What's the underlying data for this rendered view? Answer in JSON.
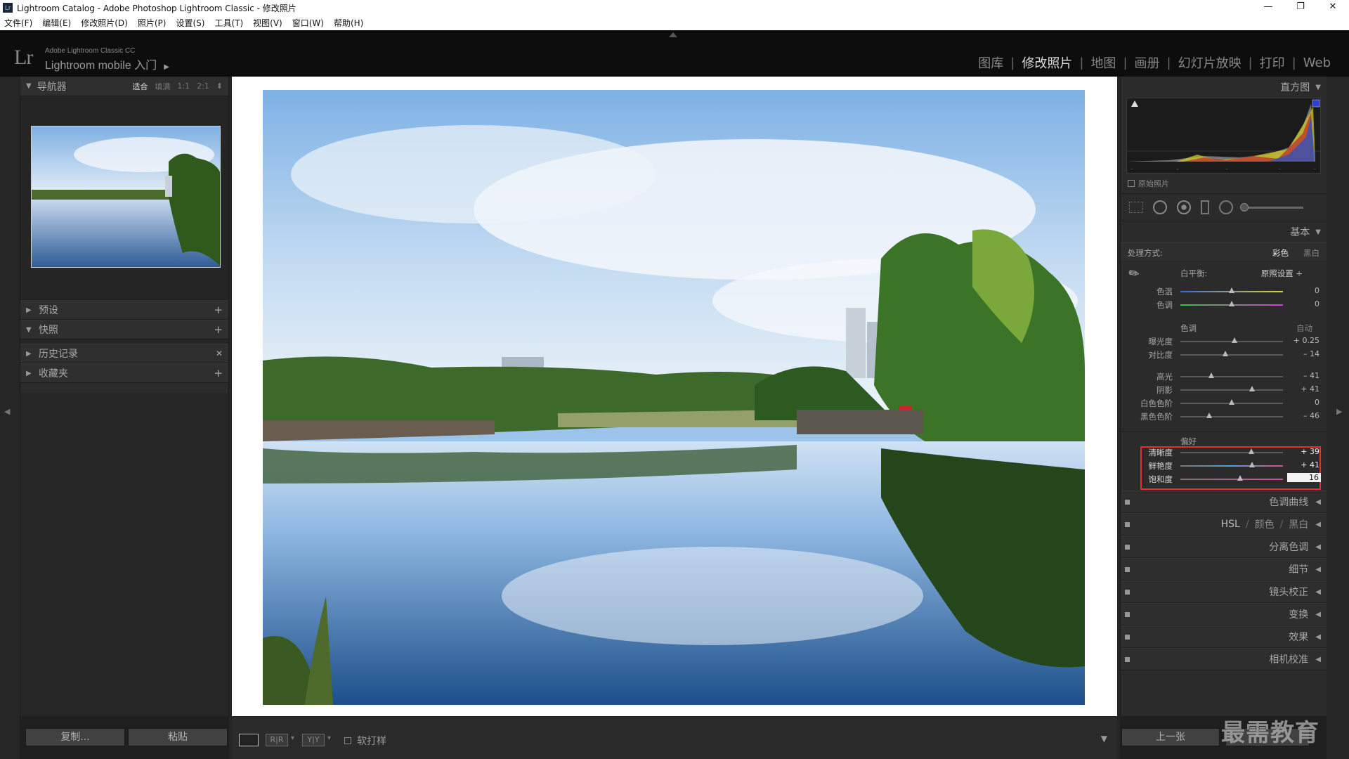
{
  "window": {
    "title": "Lightroom Catalog - Adobe Photoshop Lightroom Classic - 修改照片",
    "controls": [
      "—",
      "❐",
      "✕"
    ]
  },
  "menu": [
    "文件(F)",
    "编辑(E)",
    "修改照片(D)",
    "照片(P)",
    "设置(S)",
    "工具(T)",
    "视图(V)",
    "窗口(W)",
    "帮助(H)"
  ],
  "identity": {
    "logo": "Lr",
    "product": "Adobe Lightroom Classic CC",
    "mobile": "Lightroom mobile 入门"
  },
  "modules": {
    "items": [
      "图库",
      "修改照片",
      "地图",
      "画册",
      "幻灯片放映",
      "打印",
      "Web"
    ],
    "active": "修改照片"
  },
  "left": {
    "navigator": {
      "title": "导航器",
      "zoom": [
        "适合",
        "填满",
        "1:1",
        "2:1"
      ],
      "active_zoom": "适合"
    },
    "panels": [
      {
        "title": "预设",
        "action": "+"
      },
      {
        "title": "快照",
        "action": "+",
        "expanded": true
      },
      {
        "title": "历史记录",
        "action": "✕"
      },
      {
        "title": "收藏夹",
        "action": "+"
      }
    ],
    "copy_label": "复制...",
    "paste_label": "粘贴"
  },
  "toolbar": {
    "softproof_label": "软打样",
    "ry_label": "R|R",
    "yy_label": "Y|Y"
  },
  "right": {
    "histogram_title": "直方图",
    "original_label": "原始照片",
    "basic_title": "基本",
    "treatment_label": "处理方式:",
    "treatment_options": [
      "彩色",
      "黑白"
    ],
    "treatment_active": "彩色",
    "wb_label": "白平衡:",
    "wb_value": "原照设置 ÷",
    "wb_sliders": [
      {
        "label": "色温",
        "value": "0",
        "pos": 0.5
      },
      {
        "label": "色调",
        "value": "0",
        "pos": 0.5
      }
    ],
    "tone_label": "色调",
    "auto_label": "自动",
    "tone_sliders": [
      {
        "label": "曝光度",
        "value": "+ 0.25",
        "pos": 0.53
      },
      {
        "label": "对比度",
        "value": "– 14",
        "pos": 0.44
      }
    ],
    "tone_sliders2": [
      {
        "label": "高光",
        "value": "– 41",
        "pos": 0.3
      },
      {
        "label": "阴影",
        "value": "+ 41",
        "pos": 0.7
      },
      {
        "label": "白色色阶",
        "value": "0",
        "pos": 0.5
      },
      {
        "label": "黑色色阶",
        "value": "– 46",
        "pos": 0.28
      }
    ],
    "presence_label": "偏好",
    "presence_sliders": [
      {
        "label": "清晰度",
        "value": "+ 39",
        "pos": 0.69
      },
      {
        "label": "鲜艳度",
        "value": "+ 41",
        "pos": 0.7
      },
      {
        "label": "饱和度",
        "value": "16",
        "pos": 0.58
      }
    ],
    "collapsed_panels": [
      "色调曲线",
      "分离色调",
      "细节",
      "镜头校正",
      "变换",
      "效果",
      "相机校准"
    ],
    "hsl": {
      "a": "HSL",
      "b": "颜色",
      "c": "黑白"
    },
    "prev_label": "上一张",
    "watermark": "最需教育"
  },
  "colors": {
    "accent_highlight": "#e03030",
    "panel_bg": "#2b2b2b",
    "active_text": "#dcdcdc"
  }
}
